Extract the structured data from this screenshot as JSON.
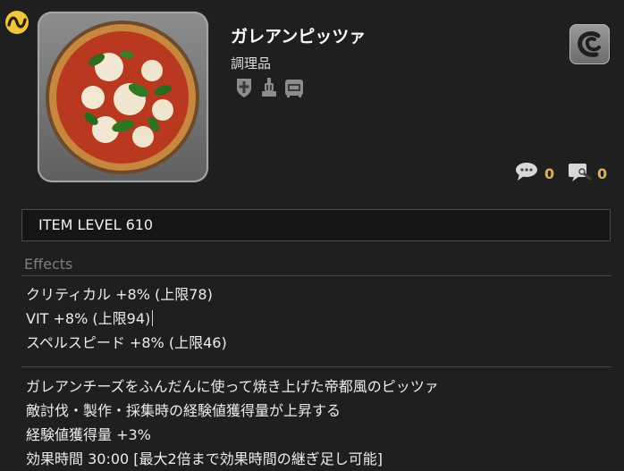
{
  "item": {
    "name": "ガレアンピッツァ",
    "category": "調理品"
  },
  "job_icons": [
    "paladin-icon",
    "alchemist-icon",
    "oven-icon"
  ],
  "social": {
    "comment_count": "0",
    "review_count": "0"
  },
  "item_level": "ITEM LEVEL 610",
  "effects": {
    "label": "Effects",
    "lines": [
      "クリティカル +8% (上限78)",
      "VIT +8% (上限94)",
      "スペルスピード +8% (上限46)"
    ]
  },
  "description": {
    "lines": [
      "ガレアンチーズをふんだんに使って焼き上げた帝都風のピッツァ",
      "敵討伐・製作・採集時の経験値獲得量が上昇する",
      "経験値獲得量 +3%",
      "効果時間 30:00 [最大2倍まで効果時間の継ぎ足し可能]"
    ]
  },
  "colors": {
    "background": "#1f1f1f",
    "accent_gold": "#d9b25c",
    "muted_label": "#7d7d7d"
  }
}
